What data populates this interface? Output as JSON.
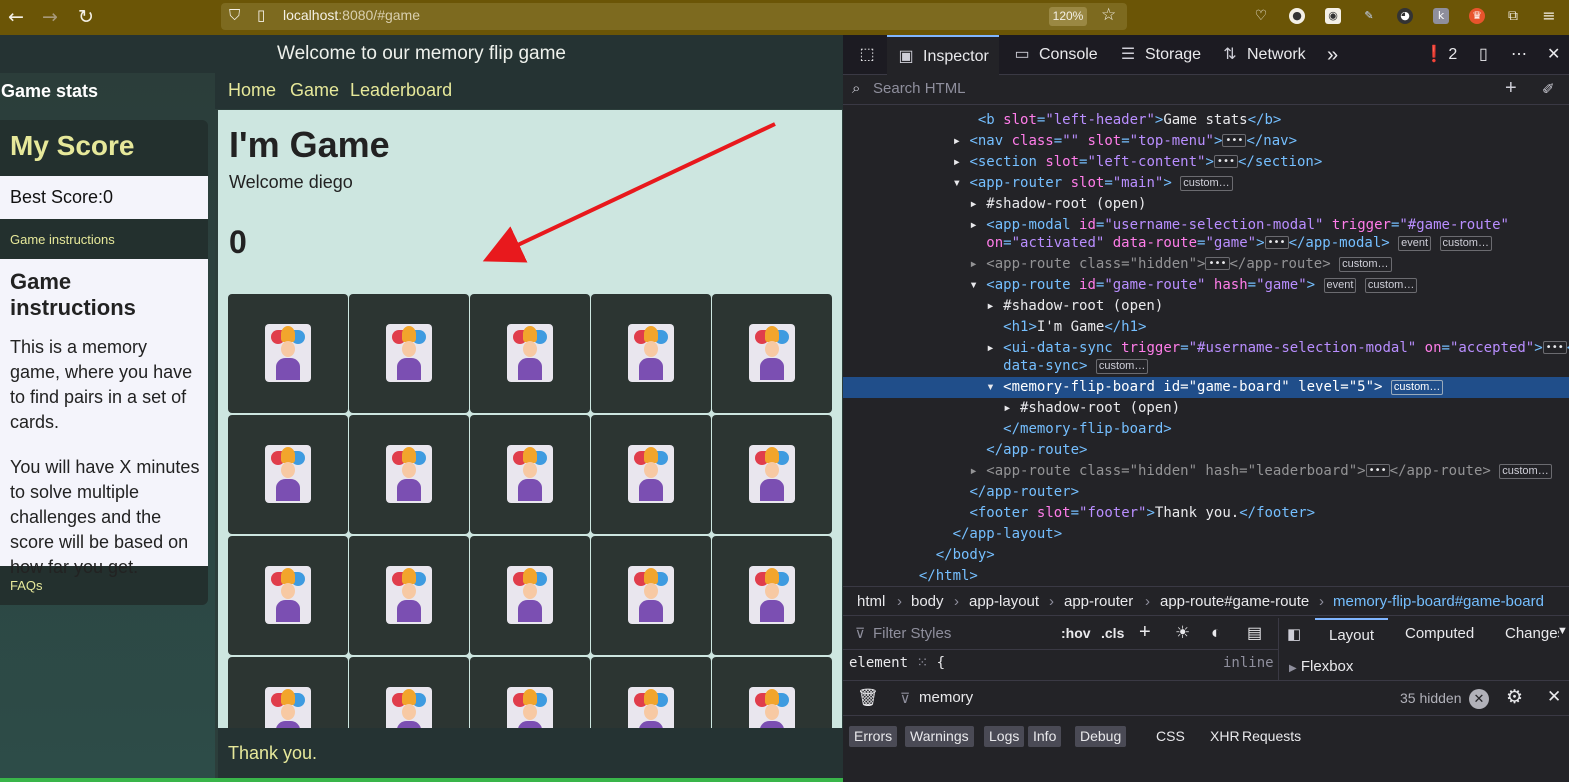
{
  "browser": {
    "url_host": "localhost",
    "url_rest": ":8080/#game",
    "zoom": "120%"
  },
  "page": {
    "header_title": "Welcome to our memory flip game",
    "left_header": "Game stats",
    "my_score_title": "My Score",
    "best_score_label": "Best Score:",
    "best_score_value": "0",
    "game_instructions_link": "Game instructions",
    "game_instructions_title": "Game instructions",
    "instructions_p1": "This is a memory game, where you have to find pairs in a set of cards.",
    "instructions_p2": "You will have X minutes to solve multiple challenges and the score will be based on how far you get.",
    "faqs_link": "FAQs",
    "nav": [
      "Home",
      "Game",
      "Leaderboard"
    ],
    "game_title": "I'm Game",
    "welcome_text": "Welcome diego",
    "score": "0",
    "footer": "Thank you."
  },
  "devtools": {
    "tabs": [
      "Inspector",
      "Console",
      "Storage",
      "Network"
    ],
    "error_count": "2",
    "search_placeholder": "Search HTML",
    "breadcrumbs": [
      "html",
      "body",
      "app-layout",
      "app-router",
      "app-route#game-route",
      "memory-flip-board#game-board"
    ],
    "filter_styles_placeholder": "Filter Styles",
    "hov": ":hov",
    "cls": ".cls",
    "element_rule": "element",
    "element_brace": "{",
    "inline": "inline",
    "layout_tabs": [
      "Layout",
      "Computed",
      "Changes"
    ],
    "flexbox": "Flexbox",
    "console_filter": "memory",
    "hidden_count": "35 hidden",
    "console_levels": [
      "Errors",
      "Warnings",
      "Logs",
      "Info",
      "Debug"
    ],
    "console_types": [
      "CSS",
      "XHR",
      "Requests"
    ]
  }
}
